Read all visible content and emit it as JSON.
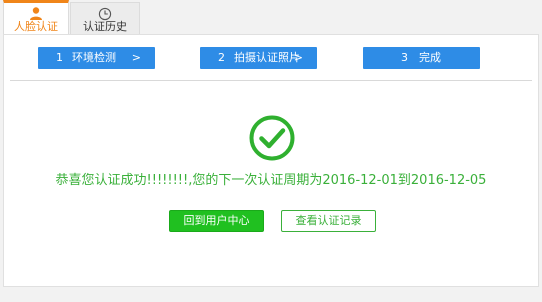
{
  "tabs": [
    {
      "label": "人脸认证",
      "icon": "person-icon",
      "active": true
    },
    {
      "label": "认证历史",
      "icon": "history-clock-icon",
      "active": false
    }
  ],
  "steps": [
    {
      "num": "1",
      "label": "环境检测",
      "arrow": ">"
    },
    {
      "num": "2",
      "label": "拍摄认证照片",
      "arrow": ">"
    },
    {
      "num": "3",
      "label": "完成"
    }
  ],
  "result": {
    "icon": "success-check-icon",
    "message": "恭喜您认证成功!!!!!!!!,您的下一次认证周期为2016-12-01到2016-12-05"
  },
  "buttons": {
    "home": "回到用户中心",
    "records": "查看认证记录"
  },
  "colors": {
    "accent_orange": "#f08519",
    "step_blue": "#2e8ce6",
    "success_green": "#3ab03a",
    "button_green": "#20c020"
  }
}
